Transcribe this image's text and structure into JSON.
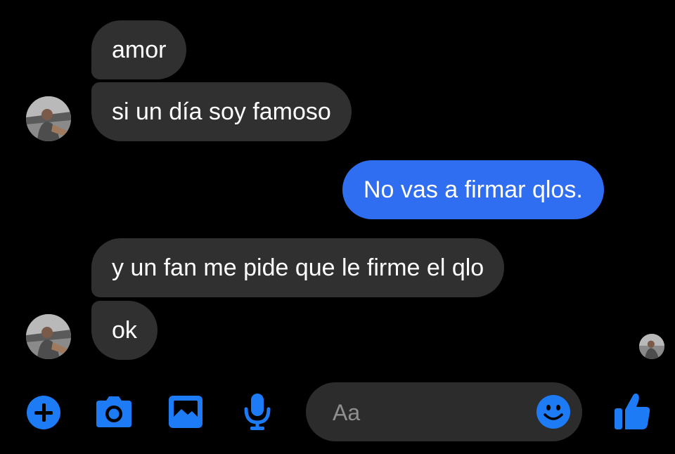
{
  "messages": [
    {
      "text": "amor",
      "sender": "them"
    },
    {
      "text": "si un día soy famoso",
      "sender": "them"
    },
    {
      "text": "No vas a firmar qlos.",
      "sender": "me"
    },
    {
      "text": "y un fan me pide que le firme el qlo",
      "sender": "them"
    },
    {
      "text": "ok",
      "sender": "them"
    }
  ],
  "composer": {
    "placeholder": "Aa"
  },
  "colors": {
    "background": "#000000",
    "incoming_bubble": "#303030",
    "outgoing_bubble": "#2f6ef0",
    "accent": "#1d7bf5"
  },
  "icons": {
    "toolbar": [
      "plus-icon",
      "camera-icon",
      "gallery-icon",
      "microphone-icon"
    ],
    "composer": "emoji-icon",
    "send": "thumbs-up-icon"
  }
}
